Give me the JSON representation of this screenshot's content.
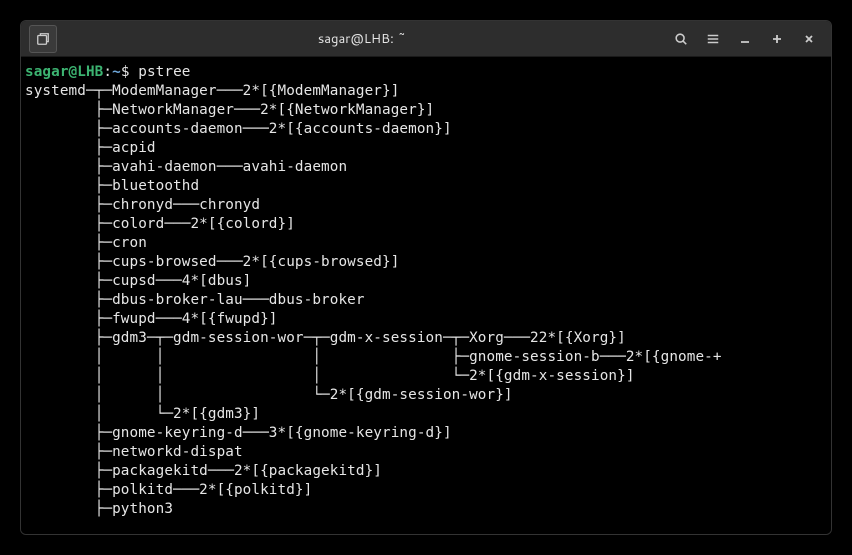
{
  "window": {
    "title": "sagar@LHB: ~"
  },
  "prompt": {
    "user_host": "sagar@LHB",
    "colon": ":",
    "path": "~",
    "dollar": "$ ",
    "command": "pstree"
  },
  "tree": [
    "systemd─┬─ModemManager───2*[{ModemManager}]",
    "        ├─NetworkManager───2*[{NetworkManager}]",
    "        ├─accounts-daemon───2*[{accounts-daemon}]",
    "        ├─acpid",
    "        ├─avahi-daemon───avahi-daemon",
    "        ├─bluetoothd",
    "        ├─chronyd───chronyd",
    "        ├─colord───2*[{colord}]",
    "        ├─cron",
    "        ├─cups-browsed───2*[{cups-browsed}]",
    "        ├─cupsd───4*[dbus]",
    "        ├─dbus-broker-lau───dbus-broker",
    "        ├─fwupd───4*[{fwupd}]",
    "        ├─gdm3─┬─gdm-session-wor─┬─gdm-x-session─┬─Xorg───22*[{Xorg}]",
    "        │      │                 │               ├─gnome-session-b───2*[{gnome-+",
    "        │      │                 │               └─2*[{gdm-x-session}]",
    "        │      │                 └─2*[{gdm-session-wor}]",
    "        │      └─2*[{gdm3}]",
    "        ├─gnome-keyring-d───3*[{gnome-keyring-d}]",
    "        ├─networkd-dispat",
    "        ├─packagekitd───2*[{packagekitd}]",
    "        ├─polkitd───2*[{polkitd}]",
    "        ├─python3"
  ]
}
